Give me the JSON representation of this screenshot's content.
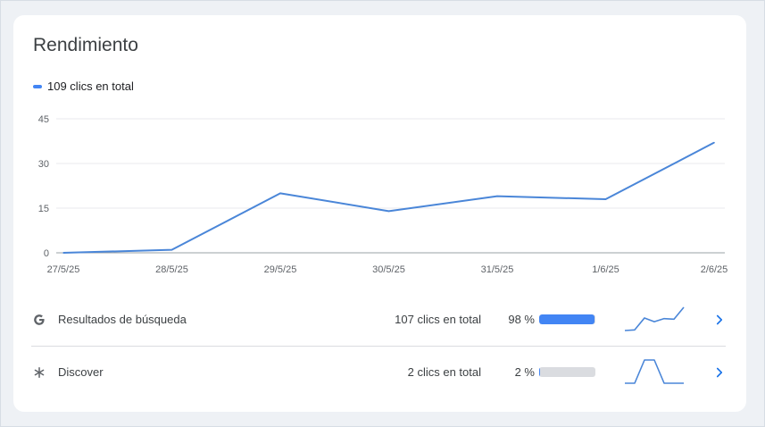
{
  "card": {
    "title": "Rendimiento"
  },
  "legend": {
    "label": "109 clics en total",
    "color": "#4285f4"
  },
  "chart_data": {
    "type": "line",
    "x": [
      "27/5/25",
      "28/5/25",
      "29/5/25",
      "30/5/25",
      "31/5/25",
      "1/6/25",
      "2/6/25"
    ],
    "series": [
      {
        "name": "109 clics en total",
        "values": [
          0,
          1,
          20,
          14,
          19,
          18,
          37
        ]
      }
    ],
    "ylim": [
      0,
      45
    ],
    "yticks": [
      0,
      15,
      30,
      45
    ],
    "grid": true,
    "line_color": "#4a86d8"
  },
  "sources": [
    {
      "icon": "google-g-icon",
      "name": "Resultados de búsqueda",
      "clicks_label": "107 clics en total",
      "percent_label": "98 %",
      "share": 0.98,
      "trend": [
        0,
        1,
        20,
        14,
        19,
        18,
        37
      ]
    },
    {
      "icon": "asterisk-icon",
      "name": "Discover",
      "clicks_label": "2 clics en total",
      "percent_label": "2 %",
      "share": 0.02,
      "trend": [
        0,
        0,
        1,
        1,
        0,
        0,
        0
      ]
    }
  ]
}
